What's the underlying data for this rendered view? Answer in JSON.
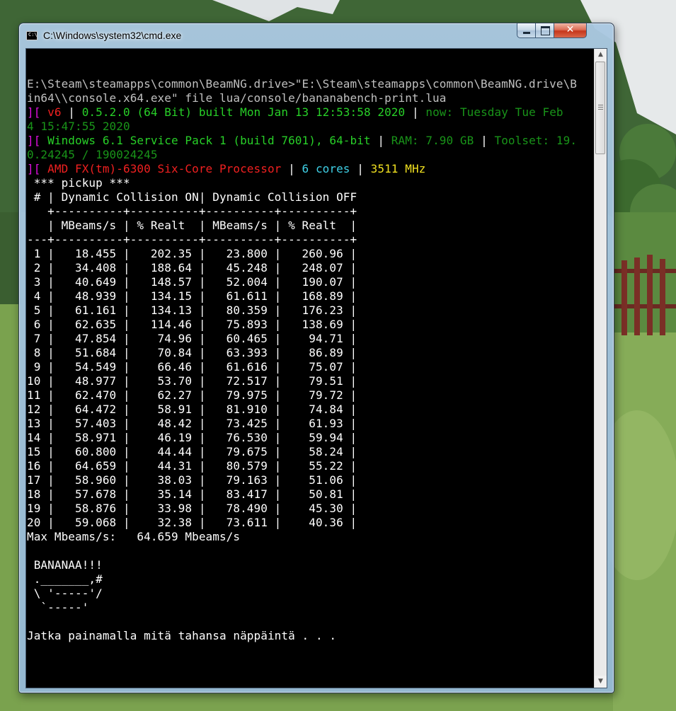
{
  "window": {
    "title": "C:\\Windows\\system32\\cmd.exe",
    "icon_text": "C:\\"
  },
  "controls": {
    "minimize": "minimize",
    "maximize": "maximize",
    "close": "✕"
  },
  "console": {
    "lines": [
      [
        [
          "",
          "gry"
        ]
      ],
      [
        [
          "E:\\Steam\\steamapps\\common\\BeamNG.drive>\"E:\\Steam\\steamapps\\common\\BeamNG.drive\\B",
          "gry"
        ]
      ],
      [
        [
          "in64\\\\console.x64.exe\" file lua/console/bananabench-print.lua",
          "gry"
        ]
      ],
      [
        [
          "][ ",
          "mag"
        ],
        [
          "v6",
          "red"
        ],
        [
          " | ",
          "wht"
        ],
        [
          "0.5.2.0 (64 Bit) built Mon Jan 13 12:53:58 2020",
          "grn"
        ],
        [
          " | ",
          "wht"
        ],
        [
          "now: Tuesday Tue Feb",
          "dgrn"
        ]
      ],
      [
        [
          "4 15:47:55 2020",
          "dgrn"
        ]
      ],
      [
        [
          "][ ",
          "mag"
        ],
        [
          "Windows 6.1 Service Pack 1 (build 7601), 64-bit",
          "grn"
        ],
        [
          " | ",
          "wht"
        ],
        [
          "RAM: 7.90 GB",
          "dgrn"
        ],
        [
          " | ",
          "wht"
        ],
        [
          "Toolset: 19.",
          "dgrn"
        ]
      ],
      [
        [
          "0.24245 / 190024245",
          "dgrn"
        ]
      ],
      [
        [
          "][ ",
          "mag"
        ],
        [
          "AMD FX(tm)-6300 Six-Core Processor",
          "red"
        ],
        [
          " | ",
          "wht"
        ],
        [
          "6 cores",
          "cyan"
        ],
        [
          " | ",
          "wht"
        ],
        [
          "3511 MHz",
          "yel"
        ]
      ],
      [
        [
          " *** pickup ***",
          "wht"
        ]
      ],
      [
        [
          " # | Dynamic Collision ON| Dynamic Collision OFF",
          "wht"
        ]
      ],
      [
        [
          "   +----------+----------+----------+----------+",
          "wht"
        ]
      ],
      [
        [
          "   | MBeams/s | % Realt  | MBeams/s | % Realt  |",
          "wht"
        ]
      ],
      [
        [
          "---+----------+----------+----------+----------+",
          "wht"
        ]
      ],
      [
        [
          " 1 |   18.455 |   202.35 |   23.800 |   260.96 |",
          "wht"
        ]
      ],
      [
        [
          " 2 |   34.408 |   188.64 |   45.248 |   248.07 |",
          "wht"
        ]
      ],
      [
        [
          " 3 |   40.649 |   148.57 |   52.004 |   190.07 |",
          "wht"
        ]
      ],
      [
        [
          " 4 |   48.939 |   134.15 |   61.611 |   168.89 |",
          "wht"
        ]
      ],
      [
        [
          " 5 |   61.161 |   134.13 |   80.359 |   176.23 |",
          "wht"
        ]
      ],
      [
        [
          " 6 |   62.635 |   114.46 |   75.893 |   138.69 |",
          "wht"
        ]
      ],
      [
        [
          " 7 |   47.854 |    74.96 |   60.465 |    94.71 |",
          "wht"
        ]
      ],
      [
        [
          " 8 |   51.684 |    70.84 |   63.393 |    86.89 |",
          "wht"
        ]
      ],
      [
        [
          " 9 |   54.549 |    66.46 |   61.616 |    75.07 |",
          "wht"
        ]
      ],
      [
        [
          "10 |   48.977 |    53.70 |   72.517 |    79.51 |",
          "wht"
        ]
      ],
      [
        [
          "11 |   62.470 |    62.27 |   79.975 |    79.72 |",
          "wht"
        ]
      ],
      [
        [
          "12 |   64.472 |    58.91 |   81.910 |    74.84 |",
          "wht"
        ]
      ],
      [
        [
          "13 |   57.403 |    48.42 |   73.425 |    61.93 |",
          "wht"
        ]
      ],
      [
        [
          "14 |   58.971 |    46.19 |   76.530 |    59.94 |",
          "wht"
        ]
      ],
      [
        [
          "15 |   60.800 |    44.44 |   79.675 |    58.24 |",
          "wht"
        ]
      ],
      [
        [
          "16 |   64.659 |    44.31 |   80.579 |    55.22 |",
          "wht"
        ]
      ],
      [
        [
          "17 |   58.960 |    38.03 |   79.163 |    51.06 |",
          "wht"
        ]
      ],
      [
        [
          "18 |   57.678 |    35.14 |   83.417 |    50.81 |",
          "wht"
        ]
      ],
      [
        [
          "19 |   58.876 |    33.98 |   78.490 |    45.30 |",
          "wht"
        ]
      ],
      [
        [
          "20 |   59.068 |    32.38 |   73.611 |    40.36 |",
          "wht"
        ]
      ],
      [
        [
          "Max Mbeams/s:   64.659 Mbeams/s",
          "wht"
        ]
      ],
      [
        [
          "",
          "wht"
        ]
      ],
      [
        [
          " BANANAA!!!",
          "wht"
        ]
      ],
      [
        [
          " ._______,#",
          "wht"
        ]
      ],
      [
        [
          " \\ '-----'/",
          "wht"
        ]
      ],
      [
        [
          "  `-----'",
          "wht"
        ]
      ],
      [
        [
          "",
          "wht"
        ]
      ],
      [
        [
          "Jatka painamalla mitä tahansa näppäintä . . .",
          "wht"
        ]
      ]
    ]
  },
  "scrollbar": {
    "up_arrow": "▲",
    "down_arrow": "▼"
  }
}
